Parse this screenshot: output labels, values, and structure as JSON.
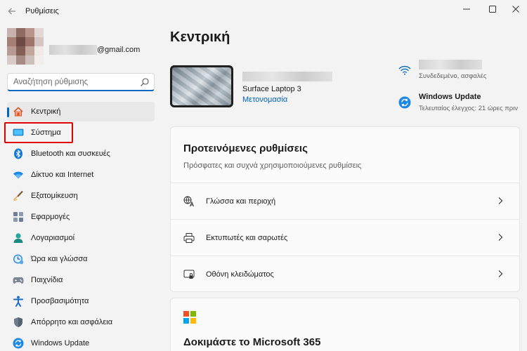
{
  "window": {
    "title": "Ρυθμίσεις",
    "back_icon": "arrow-left-icon",
    "controls": {
      "minimize": "─",
      "maximize": "☐",
      "close": "✕"
    }
  },
  "profile": {
    "email_domain": "@gmail.com"
  },
  "search": {
    "placeholder": "Αναζήτηση ρύθμισης",
    "value": ""
  },
  "sidebar": {
    "active_index": 0,
    "highlighted_index": 1,
    "items": [
      {
        "label": "Κεντρική",
        "icon": "home-icon"
      },
      {
        "label": "Σύστημα",
        "icon": "system-icon"
      },
      {
        "label": "Bluetooth και συσκευές",
        "icon": "bluetooth-icon"
      },
      {
        "label": "Δίκτυο και Internet",
        "icon": "network-icon"
      },
      {
        "label": "Εξατομίκευση",
        "icon": "brush-icon"
      },
      {
        "label": "Εφαρμογές",
        "icon": "apps-icon"
      },
      {
        "label": "Λογαριασμοί",
        "icon": "accounts-icon"
      },
      {
        "label": "Ώρα και γλώσσα",
        "icon": "time-language-icon"
      },
      {
        "label": "Παιχνίδια",
        "icon": "gaming-icon"
      },
      {
        "label": "Προσβασιμότητα",
        "icon": "accessibility-icon"
      },
      {
        "label": "Απόρρητο και ασφάλεια",
        "icon": "shield-icon"
      },
      {
        "label": "Windows Update",
        "icon": "windows-update-icon"
      }
    ]
  },
  "main": {
    "title": "Κεντρική",
    "device": {
      "model": "Surface Laptop 3",
      "rename_label": "Μετονομασία"
    },
    "network": {
      "status": "Συνδεδεμένο, ασφαλές"
    },
    "windows_update": {
      "title": "Windows Update",
      "subtitle": "Τελευταίος έλεγχος: 21 ώρες πριν"
    },
    "recommended": {
      "title": "Προτεινόμενες ρυθμίσεις",
      "subtitle": "Πρόσφατες και συχνά χρησιμοποιούμενες ρυθμίσεις",
      "items": [
        {
          "label": "Γλώσσα και περιοχή",
          "icon": "language-region-icon"
        },
        {
          "label": "Εκτυπωτές και σαρωτές",
          "icon": "printer-icon"
        },
        {
          "label": "Οθόνη κλειδώματος",
          "icon": "lock-screen-icon"
        }
      ]
    },
    "m365": {
      "title": "Δοκιμάστε το Microsoft 365"
    }
  },
  "colors": {
    "accent": "#0067c0",
    "highlight_box": "#e00000",
    "background": "#f3f3f3"
  }
}
